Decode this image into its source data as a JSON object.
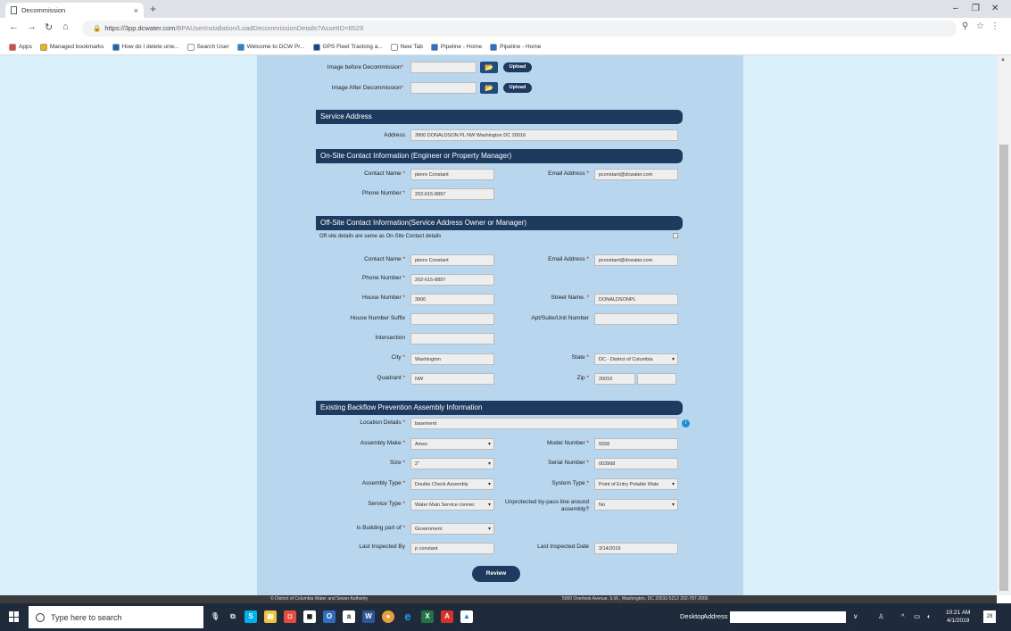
{
  "browser": {
    "tab_title": "Decommission",
    "tab_close": "×",
    "new_tab": "+",
    "url_host": "https://3pp.dcwater.com",
    "url_path": "/BPAUserInstallation/LoadDecommissionDetails?AssetID=6529",
    "window_controls": [
      "–",
      "❐",
      "✕"
    ],
    "bookmarks": [
      {
        "label": "Apps",
        "color": "#e8453c"
      },
      {
        "label": "Managed bookmarks",
        "color": "#f4b400"
      },
      {
        "label": "How do I delete unw...",
        "color": "#1565c0"
      },
      {
        "label": "Search User",
        "color": "#ffffff"
      },
      {
        "label": "Welcome to DCW Pr...",
        "color": "#1e88e5"
      },
      {
        "label": "GPS Fleet Tracking a...",
        "color": "#0d47a1"
      },
      {
        "label": "New Tab",
        "color": "#ffffff"
      },
      {
        "label": "Pipeline - Home",
        "color": "#1976d2"
      },
      {
        "label": "Pipeline - Home",
        "color": "#1976d2"
      }
    ]
  },
  "form": {
    "image_before_label": "Image before Decommission",
    "image_after_label": "Image After Decommission",
    "upload_label": "Upload",
    "folder_icon": "▬",
    "service_address_header": "Service Address",
    "address_label": "Address",
    "address_value": "3900 DONALDSON PL NW Washington DC 20016",
    "onsite_header": "On-Site Contact Information (Engineer or Property Manager)",
    "onsite": {
      "contact_name_label": "Contact Name",
      "contact_name": "pierre Constant",
      "email_label": "Email Address",
      "email": "pconstant@dcwater.com",
      "phone_label": "Phone Number",
      "phone": "202-615-8897"
    },
    "offsite_header": "Off-Site Contact Information(Service Address Owner or Manager)",
    "offsite_note": "Off-site details are same as On-Site Contact details",
    "offsite": {
      "contact_name_label": "Contact Name",
      "contact_name": "pierre Constant",
      "email_label": "Email Address",
      "email": "pconstant@dcwater.com",
      "phone_label": "Phone Number",
      "phone": "202-615-8897",
      "house_number_label": "House Number",
      "house_number": "3900",
      "street_name_label": "Street Name.",
      "street_name": "DONALDSONPL",
      "house_suffix_label": "House Number Suffix",
      "house_suffix": "",
      "apt_label": "Apt/Suite/Unit Number",
      "apt": "",
      "intersection_label": "Intersection",
      "intersection": "",
      "city_label": "City",
      "city": "Washington",
      "state_label": "State",
      "state": "DC - District of Columbia",
      "quadrant_label": "Quadrant",
      "quadrant": "NW",
      "zip_label": "Zip",
      "zip": "20016",
      "zip_ext": ""
    },
    "backflow_header": "Existing Backflow Prevention Assembly Information",
    "backflow": {
      "location_label": "Location Details",
      "location": "basement",
      "make_label": "Assembly Make",
      "make": "Ames",
      "model_label": "Model Number",
      "model": "5558",
      "size_label": "Size",
      "size": "2\"",
      "serial_label": "Serial Number",
      "serial": "003968",
      "type_label": "Assembly Type",
      "type": "Double Check Assembly",
      "system_label": "System Type",
      "system": "Point of Entry Potable Wate",
      "service_label": "Service Type",
      "service": "Water Main Service connec",
      "bypass_label": "Unprotected by-pass line around assembly?",
      "bypass": "No",
      "building_label": "Is Building part of",
      "building": "Government",
      "inspected_by_label": "Last Inspected By",
      "inspected_by": "p constant",
      "inspected_date_label": "Last Inspected Date",
      "inspected_date": "3/14/2019"
    },
    "review_label": "Review"
  },
  "footer": {
    "left": "© District of Columbia Water and Sewer Authority",
    "right": "5000 Overlook Avenue, S.W., Washington, DC 20032-5212 202-787-2000"
  },
  "taskbar": {
    "search_placeholder": "Type here to search",
    "desktop_label": "Desktop",
    "address_label": "Address",
    "time": "10:21 AM",
    "date": "4/1/2019",
    "notif_count": "28"
  }
}
